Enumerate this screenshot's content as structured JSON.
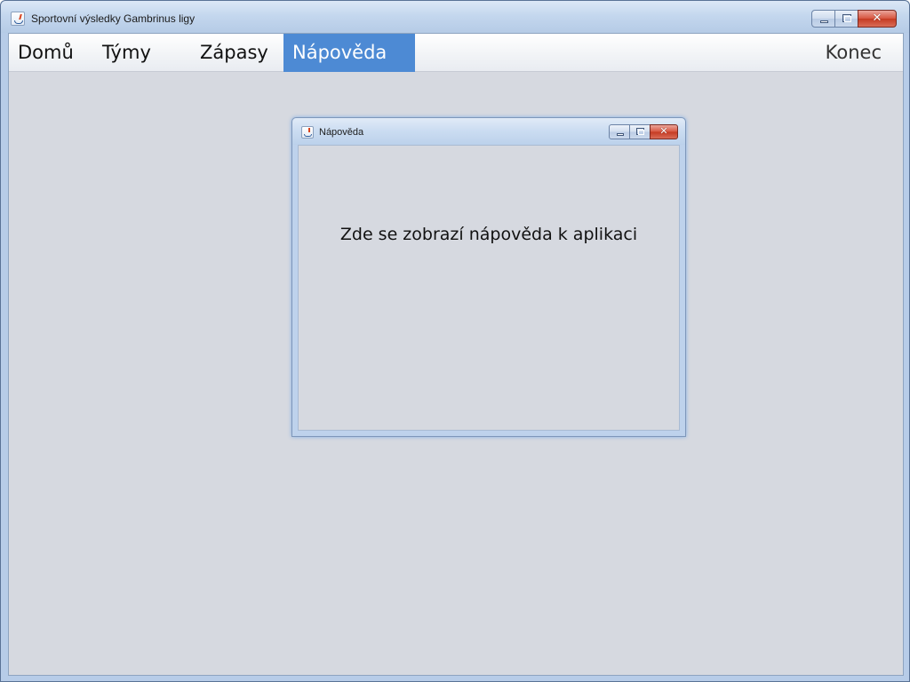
{
  "window": {
    "title": "Sportovní výsledky Gambrinus ligy",
    "icon": "java-cup-icon"
  },
  "menu": {
    "items": [
      {
        "label": "Domů",
        "active": false
      },
      {
        "label": "Týmy",
        "active": false
      },
      {
        "label": "Zápasy",
        "active": false
      },
      {
        "label": "Nápověda",
        "active": true
      }
    ],
    "exit_label": "Konec",
    "active_color": "#4d8ad4"
  },
  "help_window": {
    "title": "Nápověda",
    "icon": "java-cup-icon",
    "content_text": "Zde se zobrazí nápověda k aplikaci"
  },
  "colors": {
    "background": "#d6d9e0",
    "title_bar": "#c4d7ee",
    "close_button": "#d7553f"
  }
}
